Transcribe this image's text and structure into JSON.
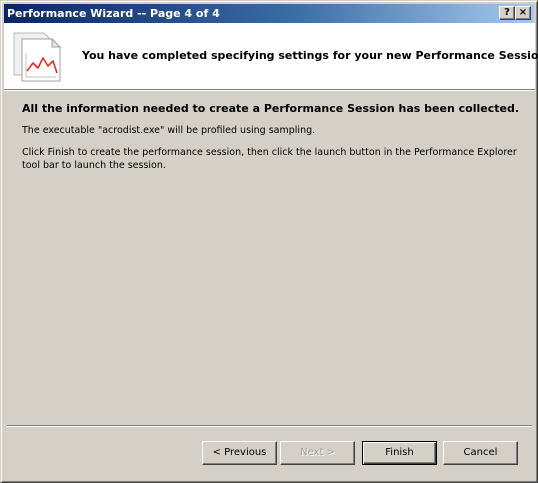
{
  "window": {
    "title": "Performance Wizard -- Page 4 of 4",
    "help_button": "?",
    "close_button": "×"
  },
  "banner": {
    "heading": "You have completed specifying settings for your new Performance Session",
    "icon": "performance-chart-icon"
  },
  "body": {
    "headline": "All the information needed to create a Performance Session has been collected.",
    "paragraphs": [
      "The executable \"acrodist.exe\" will be profiled using sampling.",
      "Click Finish to create the performance session, then click the launch button in the Performance Explorer tool bar to launch the session."
    ]
  },
  "buttons": {
    "previous": "< Previous",
    "next": "Next >",
    "finish": "Finish",
    "cancel": "Cancel"
  },
  "colors": {
    "titlebar_start": "#0a246a",
    "titlebar_end": "#a6caf0",
    "face": "#d4d0c8",
    "chart_line": "#e03020"
  }
}
